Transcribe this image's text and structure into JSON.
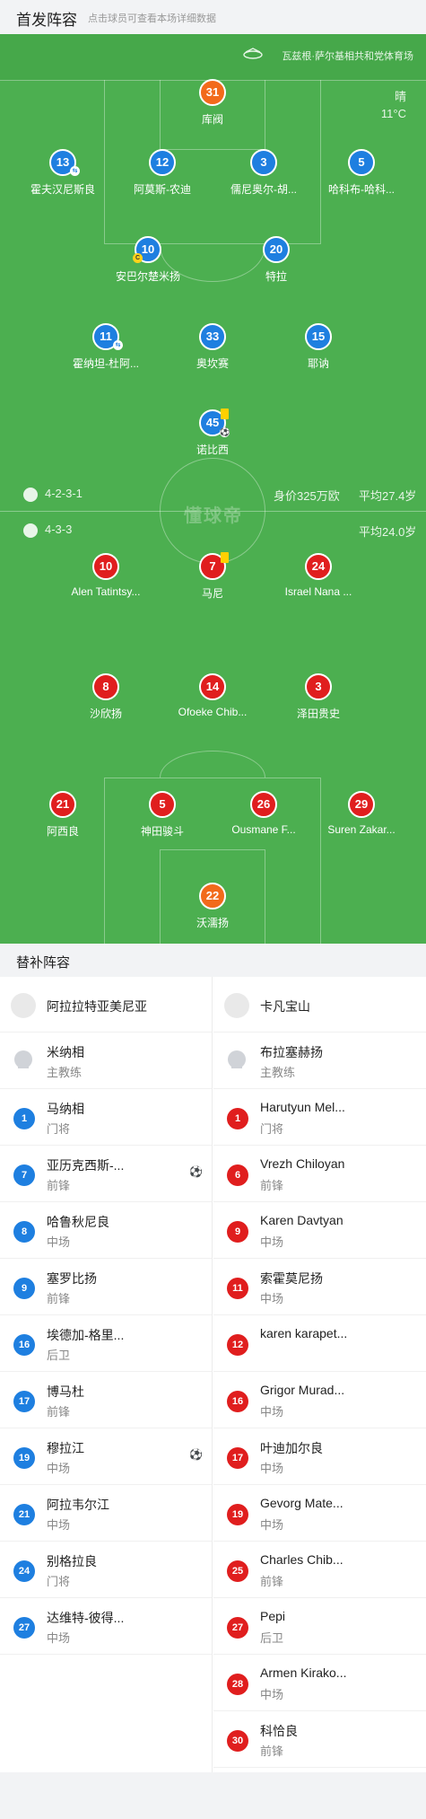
{
  "header": {
    "title": "首发阵容",
    "hint": "点击球员可查看本场详细数据"
  },
  "venue": "瓦兹根·萨尔基相共和党体育场",
  "weather": {
    "condition": "晴",
    "temperature": "11°C"
  },
  "watermark": "懂球帝",
  "home": {
    "formation": "4-2-3-1",
    "value": "身价325万欧",
    "avg_age": "平均27.4岁",
    "color": "#1e7fe0",
    "keeper_color": "#f26a1b",
    "players": [
      {
        "num": "31",
        "name": "库阀",
        "kind": "keeper"
      },
      {
        "num": "13",
        "name": "霍夫汉尼斯良",
        "badge": "sub"
      },
      {
        "num": "12",
        "name": "阿莫斯-农迪"
      },
      {
        "num": "3",
        "name": "儒尼奥尔-胡..."
      },
      {
        "num": "5",
        "name": "哈科布-哈科..."
      },
      {
        "num": "10",
        "name": "安巴尔楚米扬",
        "badge": "captain"
      },
      {
        "num": "20",
        "name": "特拉"
      },
      {
        "num": "11",
        "name": "霍纳坦-杜阿...",
        "badge": "sub"
      },
      {
        "num": "33",
        "name": "奥坎赛"
      },
      {
        "num": "15",
        "name": "耶讷"
      },
      {
        "num": "45",
        "name": "诺比西",
        "badge": "yellow-ball"
      }
    ]
  },
  "away": {
    "formation": "4-3-3",
    "avg_age": "平均24.0岁",
    "color": "#e01e1e",
    "keeper_color": "#f26a1b",
    "players": [
      {
        "num": "10",
        "name": "Alen Tatintsy..."
      },
      {
        "num": "7",
        "name": "马尼",
        "badge": "yellow"
      },
      {
        "num": "24",
        "name": "Israel Nana ..."
      },
      {
        "num": "8",
        "name": "沙欣扬"
      },
      {
        "num": "14",
        "name": "Ofoeke Chib..."
      },
      {
        "num": "3",
        "name": "泽田贵史"
      },
      {
        "num": "21",
        "name": "阿西良"
      },
      {
        "num": "5",
        "name": "神田骏斗"
      },
      {
        "num": "26",
        "name": "Ousmane F..."
      },
      {
        "num": "29",
        "name": "Suren Zakar..."
      },
      {
        "num": "22",
        "name": "沃濡扬",
        "kind": "keeper"
      }
    ]
  },
  "subs": {
    "title": "替补阵容",
    "home": {
      "team": "阿拉拉特亚美尼亚",
      "coach": {
        "name": "米纳相",
        "role": "主教练"
      },
      "players": [
        {
          "num": "1",
          "name": "马纳相",
          "pos": "门将"
        },
        {
          "num": "7",
          "name": "亚历克西斯-...",
          "pos": "前锋",
          "ball": true
        },
        {
          "num": "8",
          "name": "哈鲁秋尼良",
          "pos": "中场"
        },
        {
          "num": "9",
          "name": "塞罗比扬",
          "pos": "前锋"
        },
        {
          "num": "16",
          "name": "埃德加-格里...",
          "pos": "后卫"
        },
        {
          "num": "17",
          "name": "博马杜",
          "pos": "前锋"
        },
        {
          "num": "19",
          "name": "穆拉江",
          "pos": "中场",
          "ball": true
        },
        {
          "num": "21",
          "name": "阿拉韦尔江",
          "pos": "中场"
        },
        {
          "num": "24",
          "name": "别格拉良",
          "pos": "门将"
        },
        {
          "num": "27",
          "name": "达维特-彼得...",
          "pos": "中场"
        }
      ]
    },
    "away": {
      "team": "卡凡宝山",
      "coach": {
        "name": "布拉塞赫扬",
        "role": "主教练"
      },
      "players": [
        {
          "num": "1",
          "name": "Harutyun Mel...",
          "pos": "门将"
        },
        {
          "num": "6",
          "name": "Vrezh Chiloyan",
          "pos": "前锋"
        },
        {
          "num": "9",
          "name": "Karen Davtyan",
          "pos": "中场"
        },
        {
          "num": "11",
          "name": "索霍莫尼扬",
          "pos": "中场"
        },
        {
          "num": "12",
          "name": "karen karapet...",
          "pos": ""
        },
        {
          "num": "16",
          "name": "Grigor Murad...",
          "pos": "中场"
        },
        {
          "num": "17",
          "name": "叶迪加尔良",
          "pos": "中场"
        },
        {
          "num": "19",
          "name": "Gevorg Mate...",
          "pos": "中场"
        },
        {
          "num": "25",
          "name": "Charles Chib...",
          "pos": "前锋"
        },
        {
          "num": "27",
          "name": "Pepi",
          "pos": "后卫"
        },
        {
          "num": "28",
          "name": "Armen Kirako...",
          "pos": "中场"
        },
        {
          "num": "30",
          "name": "科恰良",
          "pos": "前锋"
        }
      ]
    }
  }
}
